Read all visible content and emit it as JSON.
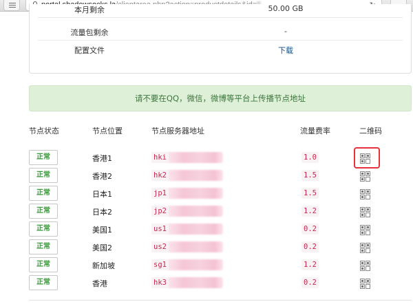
{
  "browser": {
    "url_host": "portal.shadowsocks.la",
    "url_path": "/clientarea.php?action=productdetails&id=",
    "url_tail": "5"
  },
  "info_panel": {
    "partial_row": {
      "label": "本月剩余",
      "value": "50.00 GB"
    },
    "rows": [
      {
        "label": "流量包剩余",
        "value": "-"
      },
      {
        "label": "配置文件",
        "value": "下载"
      }
    ]
  },
  "alert": {
    "text": "请不要在QQ，微信，微博等平台上传播节点地址"
  },
  "table": {
    "headers": {
      "status": "节点状态",
      "location": "节点位置",
      "address": "节点服务器地址",
      "rate": "流量费率",
      "qrcode": "二维码"
    },
    "rows": [
      {
        "status": "正常",
        "location": "香港1",
        "address": "hki",
        "rate": "1.0",
        "qr_icon": "qrcode-icon",
        "highlighted": true
      },
      {
        "status": "正常",
        "location": "香港2",
        "address": "hk2",
        "rate": "1.5",
        "qr_icon": "qrcode-icon"
      },
      {
        "status": "正常",
        "location": "日本1",
        "address": "jp1",
        "rate": "1.5",
        "qr_icon": "qrcode-icon"
      },
      {
        "status": "正常",
        "location": "日本2",
        "address": "jp2",
        "rate": "1.2",
        "qr_icon": "qrcode-icon"
      },
      {
        "status": "正常",
        "location": "美国1",
        "address": "us1",
        "rate": "0.2",
        "qr_icon": "qrcode-icon"
      },
      {
        "status": "正常",
        "location": "美国2",
        "address": "us2",
        "rate": "0.2",
        "qr_icon": "qrcode-icon"
      },
      {
        "status": "正常",
        "location": "新加坡",
        "address": "sg1",
        "rate": "1.2",
        "qr_icon": "qrcode-icon"
      },
      {
        "status": "正常",
        "location": "香港",
        "address": "hk3",
        "rate": "0.2",
        "qr_icon": "qrcode-icon"
      }
    ]
  },
  "colors": {
    "status_text": "#3c9a3c",
    "code_text": "#c7254e",
    "code_bg": "#f9f2f4",
    "alert_bg": "#dff0d8",
    "alert_text": "#3c763d",
    "highlight_border": "#e8303a",
    "link": "#0f4f8f"
  }
}
